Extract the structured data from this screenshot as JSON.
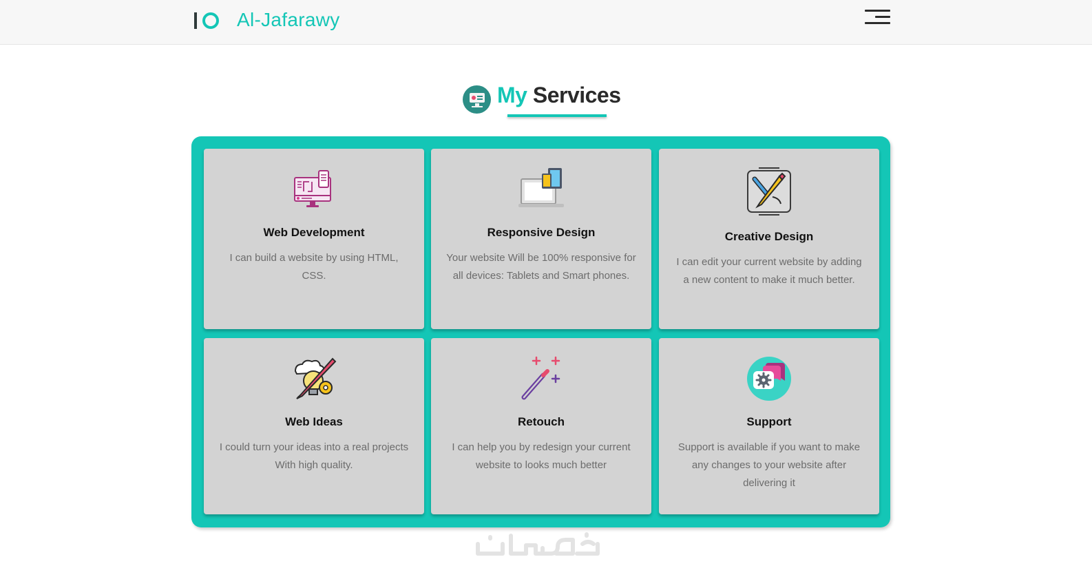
{
  "header": {
    "brand_name": "Al-Jafarawy",
    "menu_icon": "hamburger-menu-icon"
  },
  "section": {
    "title_highlight": "My",
    "title_rest": "Services",
    "title_icon": "monitor-presentation-icon",
    "accent_color": "#14c6b6"
  },
  "services": [
    {
      "title": "Web Development",
      "description": "I can build a website by using HTML, CSS.",
      "icon": "web-development-icon"
    },
    {
      "title": "Responsive Design",
      "description": "Your website Will be 100% responsive for all devices: Tablets and Smart phones.",
      "icon": "responsive-devices-icon"
    },
    {
      "title": "Creative Design",
      "description": "I can edit your current website by adding a new content to make it much better.",
      "icon": "pencil-design-icon"
    },
    {
      "title": "Web Ideas",
      "description": "I could turn your ideas into a real projects With high quality.",
      "icon": "idea-bulb-icon"
    },
    {
      "title": "Retouch",
      "description": "I can help you by redesign your current website to looks much better",
      "icon": "magic-wand-icon"
    },
    {
      "title": "Support",
      "description": "Support is available if you want to make any changes to your website after delivering it",
      "icon": "support-chat-icon"
    }
  ],
  "footer": {
    "watermark": "خمسات"
  }
}
